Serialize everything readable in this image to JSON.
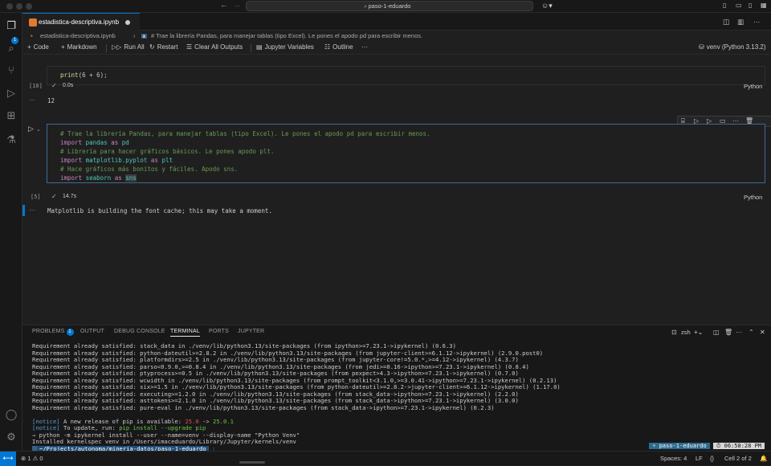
{
  "titlebar": {
    "search_text": "paso-1-eduardo",
    "nav_back": "←",
    "nav_forward": "→"
  },
  "activity": {
    "explorer_badge": "1"
  },
  "tab": {
    "label": "estadistica-descriptiva.ipynb",
    "unsaved_dot": "●"
  },
  "breadcrumb": {
    "file": "estadistica-descriptiva.ipynb",
    "separator": "›",
    "cell": "# Trae la librería Pandas, para manejar tablas (tipo Excel). Le pones el apodo pd para escribir menos."
  },
  "toolbar": {
    "code": "Code",
    "markdown": "Markdown",
    "run_all": "Run All",
    "restart": "Restart",
    "clear_all": "Clear All Outputs",
    "jupyter_vars": "Jupyter Variables",
    "outline": "Outline",
    "more": "···",
    "kernel": "venv (Python 3.13.2)"
  },
  "cells": [
    {
      "exec_count": "[10]",
      "status": "✓",
      "timing": "0.0s",
      "language": "Python",
      "output": "12"
    },
    {
      "exec_count": "[5]",
      "status": "✓",
      "timing": "14.7s",
      "language": "Python",
      "output": "Matplotlib is building the font cache; this may take a moment.",
      "code_lines": {
        "c1": "# Trae la librería Pandas, para manejar tablas (tipo Excel). Le pones el apodo pd para escribir menos.",
        "c2": "# Librería para hacer gráficos básicos. Le pones apodo plt.",
        "c3": "# Hace gráficos más bonitos y fáciles. Apodo sns."
      }
    }
  ],
  "panel": {
    "tabs": [
      "PROBLEMS",
      "OUTPUT",
      "DEBUG CONSOLE",
      "TERMINAL",
      "PORTS",
      "JUPYTER"
    ],
    "problems_badge": "1",
    "shell": "zsh"
  },
  "terminal": {
    "lines": [
      "Requirement already satisfied: stack_data in ./venv/lib/python3.13/site-packages (from ipython>=7.23.1->ipykernel) (0.6.3)",
      "Requirement already satisfied: python-dateutil>=2.8.2 in ./venv/lib/python3.13/site-packages (from jupyter-client>=6.1.12->ipykernel) (2.9.0.post0)",
      "Requirement already satisfied: platformdirs>=2.5 in ./venv/lib/python3.13/site-packages (from jupyter-core!=5.0.*,>=4.12->ipykernel) (4.3.7)",
      "Requirement already satisfied: parso<0.9.0,>=0.8.4 in ./venv/lib/python3.13/site-packages (from jedi>=0.16->ipython>=7.23.1->ipykernel) (0.8.4)",
      "Requirement already satisfied: ptyprocess>=0.5 in ./venv/lib/python3.13/site-packages (from pexpect>4.3->ipython>=7.23.1->ipykernel) (0.7.0)",
      "Requirement already satisfied: wcwidth in ./venv/lib/python3.13/site-packages (from prompt_toolkit<3.1.0,>=3.0.41->ipython>=7.23.1->ipykernel) (0.2.13)",
      "Requirement already satisfied: six>=1.5 in ./venv/lib/python3.13/site-packages (from python-dateutil>=2.8.2->jupyter-client>=6.1.12->ipykernel) (1.17.0)",
      "Requirement already satisfied: executing>=1.2.0 in ./venv/lib/python3.13/site-packages (from stack_data->ipython>=7.23.1->ipykernel) (2.2.0)",
      "Requirement already satisfied: asttokens>=2.1.0 in ./venv/lib/python3.13/site-packages (from stack_data->ipython>=7.23.1->ipykernel) (3.0.0)",
      "Requirement already satisfied: pure-eval in ./venv/lib/python3.13/site-packages (from stack_data->ipython>=7.23.1->ipykernel) (0.2.3)"
    ],
    "notice_tag": "[notice]",
    "notice1_text": " A new release of pip is available: ",
    "notice1_old": "25.0",
    "notice1_arrow": " -> ",
    "notice1_new": "25.0.1",
    "notice2_text": " To update, run: ",
    "notice2_cmd": "pip install --upgrade pip",
    "command": "→ python -m ipykernel install --user --name=venv --display-name \"Python Venv\"",
    "installed": "Installed kernelspec venv in /Users/imaceduardo/Library/Jupyter/kernels/venv",
    "prompt_path": "~/Projects/autonoma/mineria-datos/paso-1-eduardo",
    "prompt_branch": "paso-1-eduardo",
    "prompt_time": "06:58:28 PM"
  },
  "statusbar": {
    "problems": "⊗ 1 ⚠ 0",
    "spaces": "Spaces: 4",
    "eol": "LF",
    "braces": "{}",
    "cell_pos": "Cell 2 of 2"
  },
  "colors": {
    "accent": "#0078d4",
    "success": "#89d185"
  }
}
